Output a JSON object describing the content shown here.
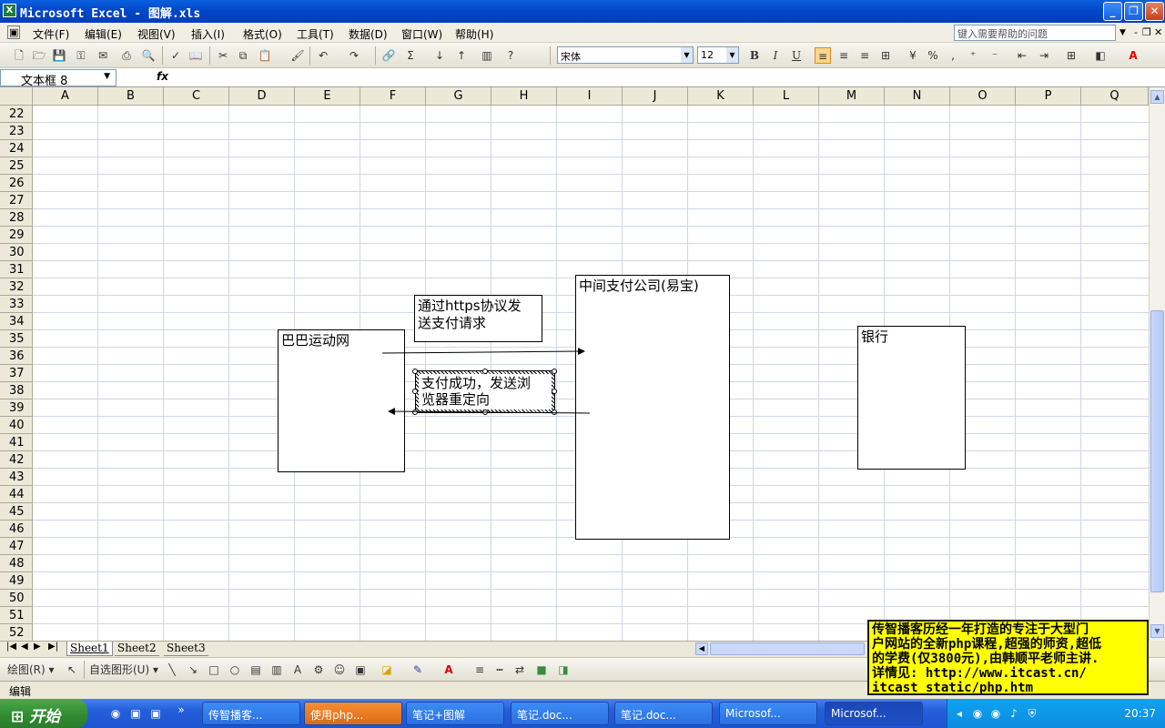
{
  "window": {
    "title": "Microsoft Excel - 图解.xls",
    "app_icon": "excel-icon"
  },
  "menu": [
    "文件(F)",
    "编辑(E)",
    "视图(V)",
    "插入(I)",
    "格式(O)",
    "工具(T)",
    "数据(D)",
    "窗口(W)",
    "帮助(H)"
  ],
  "help_box": {
    "placeholder": "键入需要帮助的问题"
  },
  "toolbar": {
    "font": "宋体",
    "size": "12"
  },
  "formula_bar": {
    "name_box": "文本框 8",
    "fx": "fx",
    "content": ""
  },
  "columns": [
    "A",
    "B",
    "C",
    "D",
    "E",
    "F",
    "G",
    "H",
    "I",
    "J",
    "K",
    "L",
    "M",
    "N",
    "O",
    "P",
    "Q"
  ],
  "rows": [
    "22",
    "23",
    "24",
    "25",
    "26",
    "27",
    "28",
    "29",
    "30",
    "31",
    "32",
    "33",
    "34",
    "35",
    "36",
    "37",
    "38",
    "39",
    "40",
    "41",
    "42",
    "43",
    "44",
    "45",
    "46",
    "47",
    "48",
    "49",
    "50",
    "51",
    "52"
  ],
  "shapes": {
    "baba": "巴巴运动网",
    "middle": "中间支付公司(易宝)",
    "bank": "银行",
    "https_note": [
      "通过https协议发",
      "送支付请求"
    ],
    "success_note": [
      "支付成功，发送浏",
      "览器重定向"
    ]
  },
  "sheets": [
    "Sheet1",
    "Sheet2",
    "Sheet3"
  ],
  "drawing_toolbar": {
    "draw": "绘图(R)",
    "autoshapes": "自选图形(U)"
  },
  "status": "编辑",
  "taskbar": {
    "start": "开始",
    "tasks": [
      "传智播客...",
      "使用php...",
      "笔记+图解",
      "笔记.doc...",
      "笔记.doc...",
      "Microsof...",
      "Microsof..."
    ],
    "clock": "20:37"
  },
  "ad": [
    "传智播客历经一年打造的专注于大型门",
    "户网站的全新php课程,超强的师资,超低",
    "的学费(仅3800元),由韩顺平老师主讲.",
    "详情见: http://www.itcast.cn/",
    "itcast_static/php.htm"
  ]
}
